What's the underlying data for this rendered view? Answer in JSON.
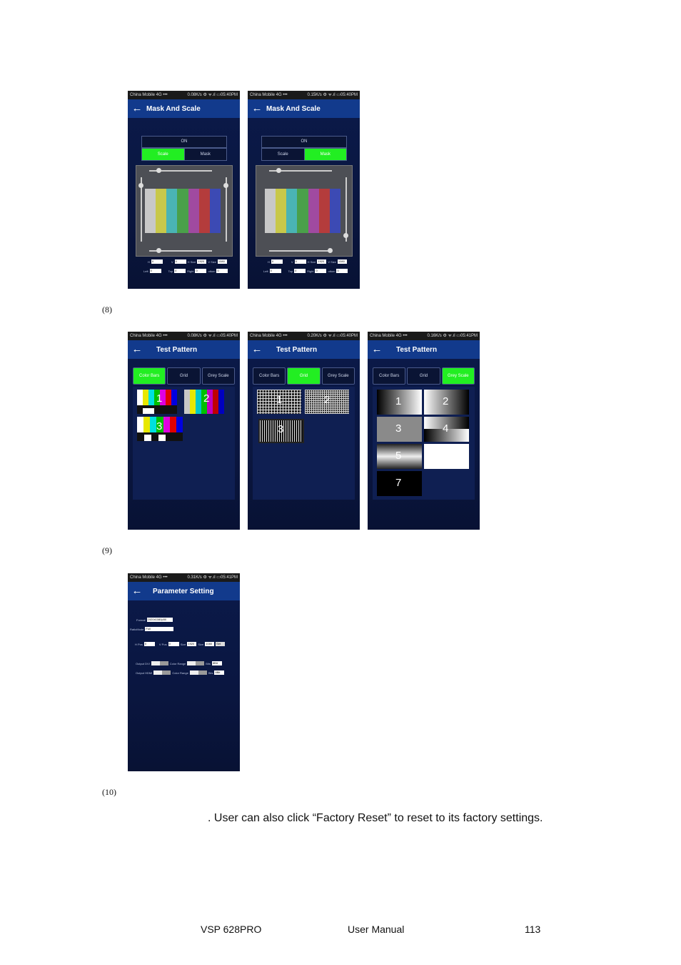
{
  "status": {
    "carrier": "China Mobile 4G •••",
    "shots": [
      "0.08K/s ⚙ ᯤ.ıl ▭05:40PM",
      "0.15K/s ⚙ ᯤ.ıl ▭05:40PM",
      "0.08K/s ⚙ ᯤ.ıl ▭05:40PM",
      "0.20K/s ⚙ ᯤ.ıl ▭05:40PM",
      "0.16K/s ⚙ ᯤ.ıl ▭05:41PM",
      "0.31K/s ⚙ ᯤ.ıl ▭05:41PM"
    ]
  },
  "mask_scale": {
    "title": "Mask And Scale",
    "on_label": "ON",
    "scale_label": "Scale",
    "mask_label": "Mask",
    "row1": {
      "h_label": "H",
      "h_val": "0",
      "v_label": "V",
      "v_val": "0",
      "hsize_label": "H Size",
      "hsize_val": "1920",
      "vsize_label": "V Size",
      "vsize_val": "1080"
    },
    "row2": {
      "left_label": "Left",
      "left_val": "0",
      "top_label": "Top",
      "top_val": "0",
      "right_label": "Right",
      "right_val": "0",
      "bottom_label": "ottom",
      "bottom_val": "0"
    },
    "slider_minus": "−",
    "slider_plus": "+"
  },
  "test_pattern": {
    "title": "Test Pattern",
    "tabs": [
      "Color Bars",
      "Grid",
      "Grey Scale"
    ],
    "n1": "1",
    "n2": "2",
    "n3": "3",
    "n4": "4",
    "n5": "5",
    "n7": "7"
  },
  "param": {
    "title": "Parameter Setting",
    "format_label": "Format",
    "format_val": "1920x1080p50",
    "ratio_label": "RatioMode",
    "ratio_val": "Full",
    "hpos_label": "H Pos",
    "hpos_val": "0",
    "vpos_label": "V Pos",
    "vpos_val": "0",
    "hsize_label": "Size",
    "hsize_val": "1920",
    "vsize_label": "Size",
    "vsize_val": "1080",
    "set_label": "Set",
    "out_dvi_label": "Output DVI",
    "out_hdmi_label": "Output HDMI",
    "color_range_label": "Color Range",
    "bits_label": "Bits",
    "bits_val": "8Bit"
  },
  "captions": {
    "c8": "(8)",
    "c9": "(9)",
    "c10": "(10)"
  },
  "body_text": ". User can also click “Factory Reset” to reset to its factory settings.",
  "footer": {
    "product": "VSP 628PRO",
    "doc": "User Manual",
    "page": "113"
  },
  "colors": {
    "bar_colors": [
      "#c8c8c8",
      "#c8c84a",
      "#4ab4b4",
      "#4aa04a",
      "#a04aa0",
      "#b43c3c",
      "#3c4ab4"
    ],
    "active": "#22ee22",
    "navy": "#0b1a4a"
  }
}
